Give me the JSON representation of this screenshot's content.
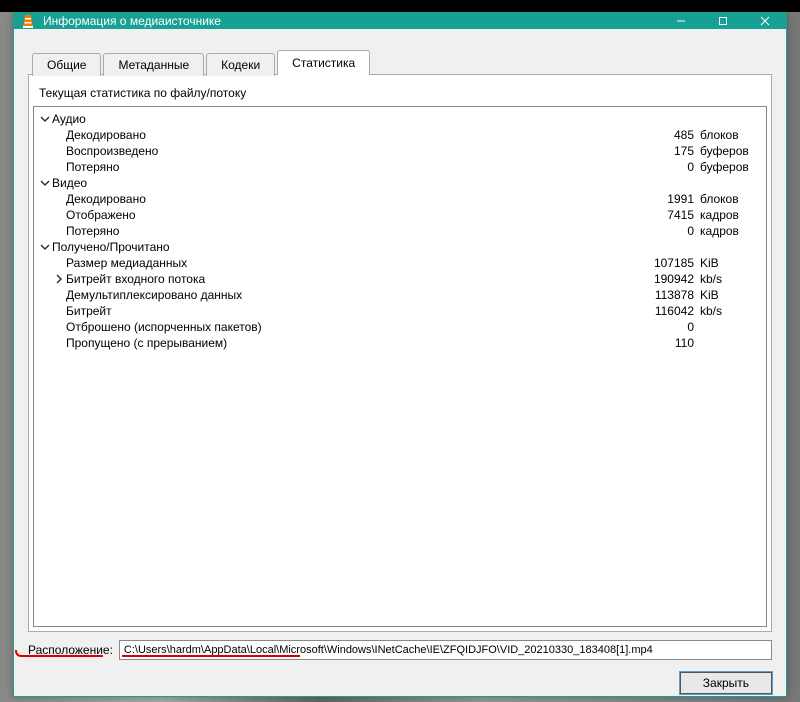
{
  "window_title": "Информация о медиаисточнике",
  "tabs": {
    "t0": "Общие",
    "t1": "Метаданные",
    "t2": "Кодеки",
    "t3": "Статистика"
  },
  "pane_label": "Текущая статистика по файлу/потоку",
  "groups": {
    "audio": {
      "label": "Аудио",
      "rows": [
        {
          "label": "Декодировано",
          "value": "485",
          "unit": "блоков"
        },
        {
          "label": "Воспроизведено",
          "value": "175",
          "unit": "буферов"
        },
        {
          "label": "Потеряно",
          "value": "0",
          "unit": "буферов"
        }
      ]
    },
    "video": {
      "label": "Видео",
      "rows": [
        {
          "label": "Декодировано",
          "value": "1991",
          "unit": "блоков"
        },
        {
          "label": "Отображено",
          "value": "7415",
          "unit": "кадров"
        },
        {
          "label": "Потеряно",
          "value": "0",
          "unit": "кадров"
        }
      ]
    },
    "recv": {
      "label": "Получено/Прочитано",
      "rows": [
        {
          "label": "Размер медиаданных",
          "value": "107185",
          "unit": "KiB",
          "exp": null
        },
        {
          "label": "Битрейт входного потока",
          "value": "190942",
          "unit": "kb/s",
          "exp": "closed"
        },
        {
          "label": "Демультиплексировано данных",
          "value": "113878",
          "unit": "KiB",
          "exp": null
        },
        {
          "label": "Битрейт",
          "value": "116042",
          "unit": "kb/s",
          "exp": null
        },
        {
          "label": "Отброшено (испорченных пакетов)",
          "value": "0",
          "unit": "",
          "exp": null
        },
        {
          "label": "Пропущено (с прерыванием)",
          "value": "110",
          "unit": "",
          "exp": null
        }
      ]
    }
  },
  "location_label": "Расположение:",
  "location_value": "C:\\Users\\hardm\\AppData\\Local\\Microsoft\\Windows\\INetCache\\IE\\ZFQIDJFO\\VID_20210330_183408[1].mp4",
  "close_button": "Закрыть"
}
